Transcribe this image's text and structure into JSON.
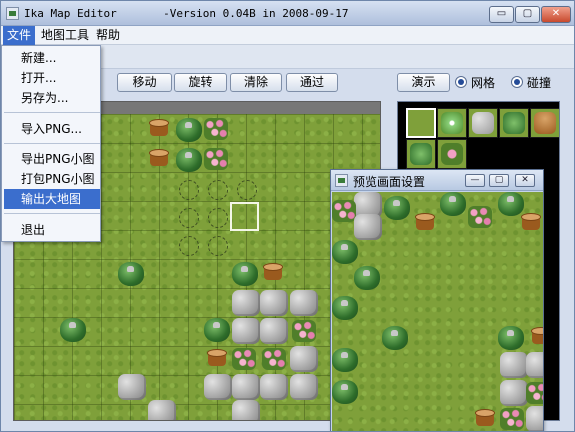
{
  "window": {
    "title": "Ika Map Editor       -Version 0.04B in 2008-09-17",
    "minimize_label": "▭",
    "maximize_label": "▢",
    "close_label": "✕"
  },
  "menubar": {
    "items": [
      {
        "label": "文件"
      },
      {
        "label": "地图工具"
      },
      {
        "label": "帮助"
      }
    ]
  },
  "file_menu": {
    "items": [
      {
        "label": "新建..."
      },
      {
        "label": "打开..."
      },
      {
        "label": "另存为..."
      },
      {
        "label": "导入PNG..."
      },
      {
        "label": "导出PNG小图"
      },
      {
        "label": "打包PNG小图"
      },
      {
        "label": "输出大地图"
      },
      {
        "label": "退出"
      }
    ],
    "highlighted": "输出大地图"
  },
  "toolbar": {
    "buttons": [
      {
        "label": "移动"
      },
      {
        "label": "旋转"
      },
      {
        "label": "清除"
      },
      {
        "label": "通过"
      }
    ],
    "demo_label": "演示",
    "grid_label": "网格",
    "collision_label": "碰撞"
  },
  "preview_window": {
    "title": "预览画面设置",
    "minimize_label": "—",
    "maximize_label": "▢",
    "close_label": "✕"
  },
  "colors": {
    "menu_highlight": "#3b6ecd",
    "grass": "#7fa03a",
    "window_chrome": "#b9c9e2"
  },
  "icons": [
    "app-icon",
    "stump-icon",
    "bush-icon",
    "flower-icon",
    "stone-icon"
  ]
}
